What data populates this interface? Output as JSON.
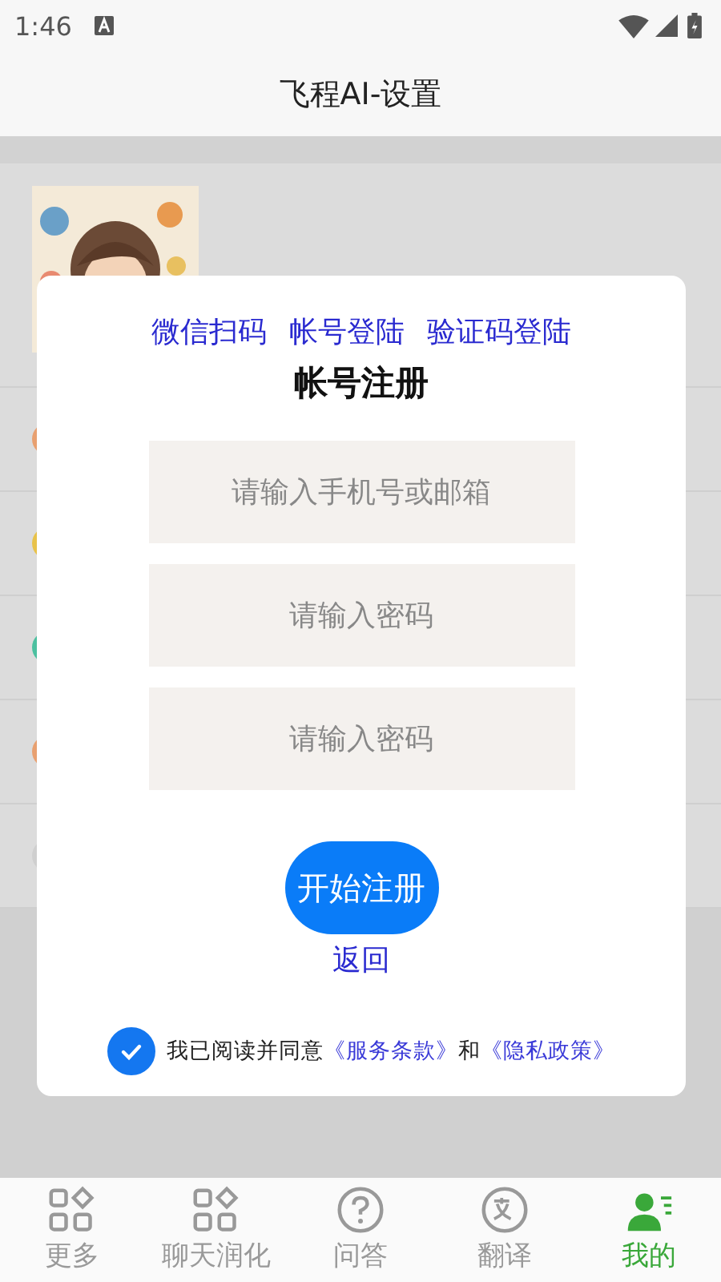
{
  "status_bar": {
    "time": "1:46"
  },
  "header": {
    "title": "飞程AI-设置"
  },
  "settings_rows": [
    {
      "color": "#e8a070"
    },
    {
      "color": "#e8c24a"
    },
    {
      "color": "#4cc0a0"
    },
    {
      "color": "#e8a070"
    },
    {
      "color": "#cfcfcf"
    }
  ],
  "dialog": {
    "login_options": [
      "微信扫码",
      "帐号登陆",
      "验证码登陆"
    ],
    "title": "帐号注册",
    "fields": [
      {
        "placeholder": "请输入手机号或邮箱"
      },
      {
        "placeholder": "请输入密码"
      },
      {
        "placeholder": "请输入密码"
      }
    ],
    "submit": "开始注册",
    "back": "返回",
    "agreement": {
      "checked": true,
      "text": "我已阅读并同意",
      "link_1": "《服务条款》",
      "joiner": "和",
      "link_2": "《隐私政策》"
    }
  },
  "nav": [
    {
      "kind": "grid",
      "label": "更多",
      "selected": false
    },
    {
      "kind": "grid",
      "label": "聊天润化",
      "selected": false
    },
    {
      "kind": "question",
      "label": "问答",
      "selected": false
    },
    {
      "kind": "translate",
      "label": "翻译",
      "selected": false
    },
    {
      "kind": "person",
      "label": "我的",
      "selected": true
    }
  ]
}
